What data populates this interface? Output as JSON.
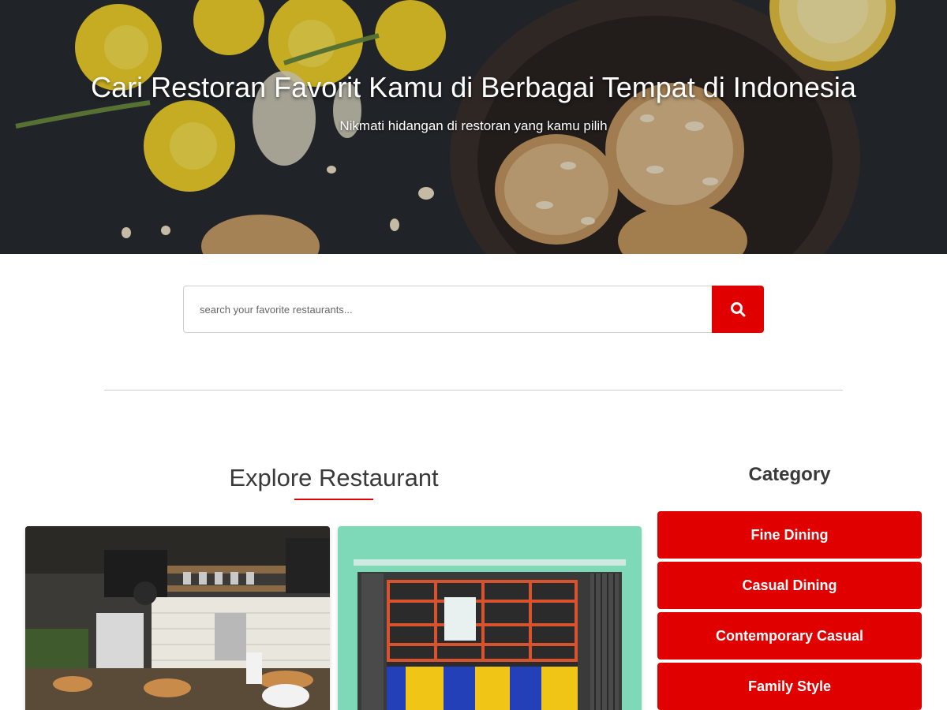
{
  "hero": {
    "title": "Cari Restoran Favorit Kamu di Berbagai Tempat di Indonesia",
    "subtitle": "Nikmati hidangan di restoran yang kamu pilih"
  },
  "search": {
    "placeholder": "search your favorite restaurants...",
    "button_icon": "search-icon"
  },
  "explore": {
    "title": "Explore Restaurant"
  },
  "category": {
    "title": "Category",
    "items": [
      "Fine Dining",
      "Casual Dining",
      "Contemporary Casual",
      "Family Style"
    ]
  },
  "colors": {
    "accent": "#e00000",
    "heading": "#3a3a3a"
  }
}
